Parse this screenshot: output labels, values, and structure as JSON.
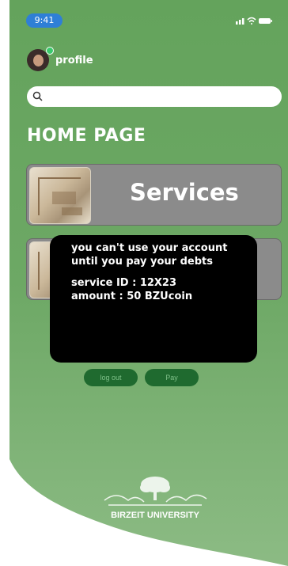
{
  "status_bar": {
    "time": "9:41"
  },
  "profile": {
    "label": "profile"
  },
  "search": {
    "placeholder": ""
  },
  "page": {
    "title": "HOME PAGE"
  },
  "cards": [
    {
      "label": "Services"
    },
    {
      "label": ""
    }
  ],
  "dialog": {
    "line1": "you can't use your account",
    "line2": "until you  pay your debts",
    "service_line": "service ID : 12X23",
    "amount_line": "amount : 50 BZUcoin"
  },
  "buttons": {
    "logout": "log out",
    "pay": "Pay"
  },
  "logo": {
    "university": "BIRZEIT UNIVERSITY"
  },
  "colors": {
    "background_green": "#6fa766",
    "card_gray": "#8b8b8b",
    "dialog": "#000000",
    "button_green": "#1f6a2f",
    "time_pill": "#2f7fd6"
  },
  "icons": [
    "signal-icon",
    "wifi-icon",
    "battery-icon",
    "search-icon",
    "tree-logo-icon"
  ]
}
